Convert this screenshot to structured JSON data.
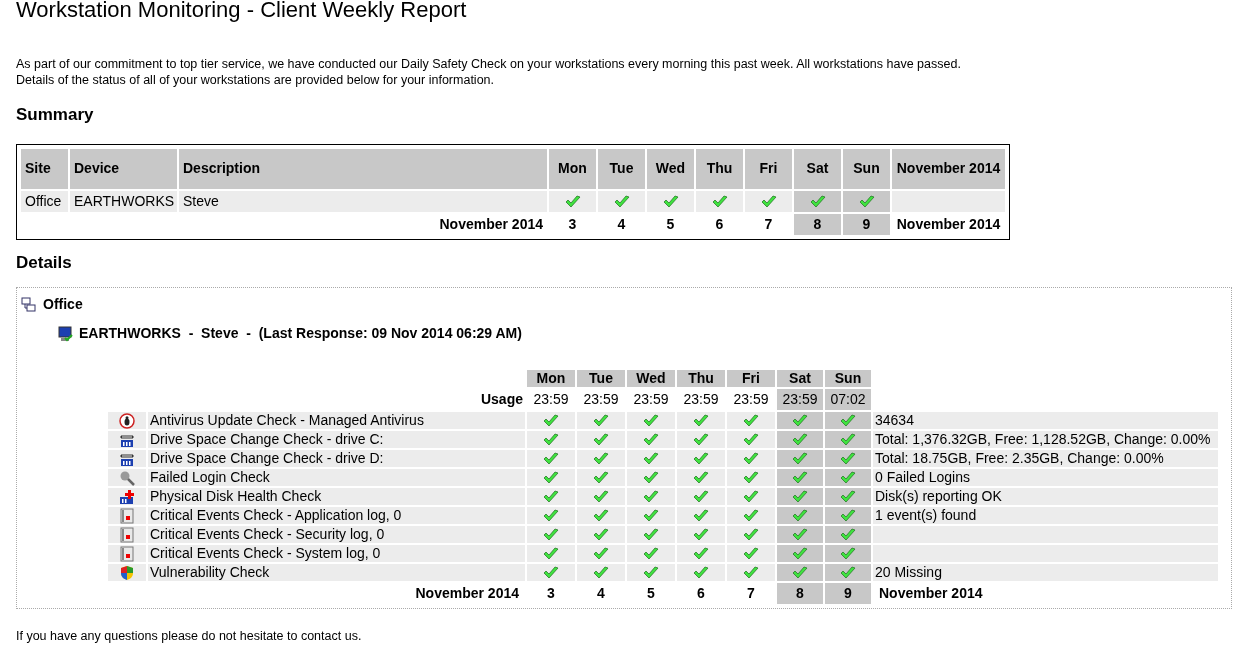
{
  "title": "Workstation Monitoring - Client Weekly Report",
  "intro": [
    "As part of our commitment to top tier service, we have conducted our Daily Safety Check on your workstations every morning this past week. All workstations have passed.",
    "Details of the status of all of your workstations are provided below for your information."
  ],
  "summary": {
    "heading": "Summary",
    "columns": [
      "Site",
      "Device",
      "Description"
    ],
    "month_heading": "November 2014",
    "days": [
      {
        "name": "Mon",
        "date": "3",
        "weekend": false
      },
      {
        "name": "Tue",
        "date": "4",
        "weekend": false
      },
      {
        "name": "Wed",
        "date": "5",
        "weekend": false
      },
      {
        "name": "Thu",
        "date": "6",
        "weekend": false
      },
      {
        "name": "Fri",
        "date": "7",
        "weekend": false
      },
      {
        "name": "Sat",
        "date": "8",
        "weekend": true
      },
      {
        "name": "Sun",
        "date": "9",
        "weekend": true
      }
    ],
    "rows": [
      {
        "site": "Office",
        "device": "EARTHWORKS",
        "description": "Steve",
        "passed": [
          true,
          true,
          true,
          true,
          true,
          true,
          true
        ]
      }
    ],
    "footer_month": "November 2014",
    "footer_month_right": "November 2014"
  },
  "details": {
    "heading": "Details",
    "site": "Office",
    "device_line": "EARTHWORKS  -  Steve  -  (Last Response: 09 Nov 2014 06:29 AM)",
    "days": [
      {
        "name": "Mon",
        "date": "3",
        "weekend": false
      },
      {
        "name": "Tue",
        "date": "4",
        "weekend": false
      },
      {
        "name": "Wed",
        "date": "5",
        "weekend": false
      },
      {
        "name": "Thu",
        "date": "6",
        "weekend": false
      },
      {
        "name": "Fri",
        "date": "7",
        "weekend": false
      },
      {
        "name": "Sat",
        "date": "8",
        "weekend": true
      },
      {
        "name": "Sun",
        "date": "9",
        "weekend": true
      }
    ],
    "usage_label": "Usage",
    "usage": [
      "23:59",
      "23:59",
      "23:59",
      "23:59",
      "23:59",
      "23:59",
      "07:02"
    ],
    "checks": [
      {
        "kind": "antivirus",
        "name": "Antivirus Update Check - Managed Antivirus",
        "passed": [
          true,
          true,
          true,
          true,
          true,
          true,
          true
        ],
        "info": "34634"
      },
      {
        "kind": "drive",
        "name": "Drive Space Change Check - drive C:",
        "passed": [
          true,
          true,
          true,
          true,
          true,
          true,
          true
        ],
        "info": "Total: 1,376.32GB, Free: 1,128.52GB, Change: 0.00%"
      },
      {
        "kind": "drive",
        "name": "Drive Space Change Check - drive D:",
        "passed": [
          true,
          true,
          true,
          true,
          true,
          true,
          true
        ],
        "info": "Total: 18.75GB, Free: 2.35GB, Change: 0.00%"
      },
      {
        "kind": "login",
        "name": "Failed Login Check",
        "passed": [
          true,
          true,
          true,
          true,
          true,
          true,
          true
        ],
        "info": "0 Failed Logins"
      },
      {
        "kind": "disk",
        "name": "Physical Disk Health Check",
        "passed": [
          true,
          true,
          true,
          true,
          true,
          true,
          true
        ],
        "info": "Disk(s) reporting OK"
      },
      {
        "kind": "events",
        "name": "Critical Events Check - Application log, 0",
        "passed": [
          true,
          true,
          true,
          true,
          true,
          true,
          true
        ],
        "info": "1 event(s) found"
      },
      {
        "kind": "events",
        "name": "Critical Events Check - Security log, 0",
        "passed": [
          true,
          true,
          true,
          true,
          true,
          true,
          true
        ]
      },
      {
        "kind": "events",
        "name": "Critical Events Check - System log, 0",
        "passed": [
          true,
          true,
          true,
          true,
          true,
          true,
          true
        ]
      },
      {
        "kind": "shield",
        "name": "Vulnerability Check",
        "passed": [
          true,
          true,
          true,
          true,
          true,
          true,
          true
        ],
        "info": "20 Missing"
      }
    ],
    "footer_month": "November 2014",
    "footer_month_right": "November 2014"
  },
  "closing": "If you have any questions please do not hesitate to contact us."
}
